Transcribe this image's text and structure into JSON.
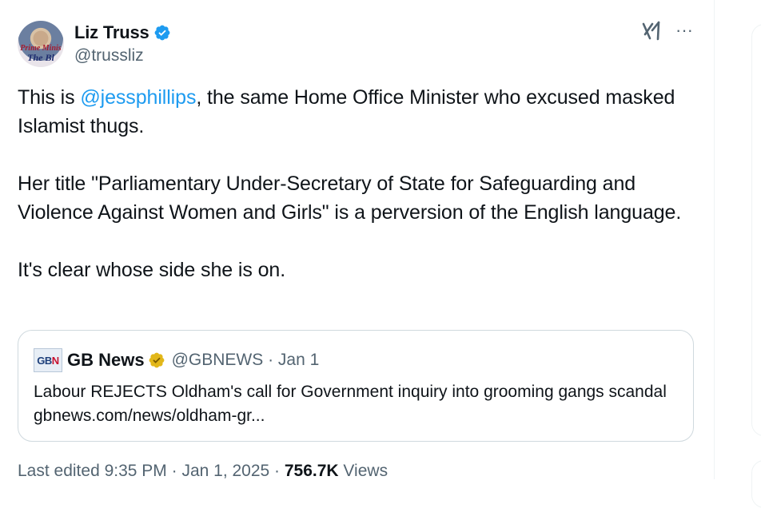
{
  "author": {
    "name": "Liz Truss",
    "handle": "@trussliz",
    "verified_icon": "verified-badge-icon",
    "avatar_lines": [
      "Prime Minis",
      "The Bl"
    ]
  },
  "header_actions": {
    "grok_icon": "grok-icon",
    "more_icon": "more-options-icon",
    "more_label": "···"
  },
  "tweet": {
    "p1_prefix": "This is ",
    "p1_mention": "@jessphillips",
    "p1_suffix": ", the same Home Office Minister who excused masked Islamist thugs.",
    "p2": "Her title \"Parliamentary Under-Secretary of State for Safeguarding and Violence Against Women and Girls\" is a perversion of the English language.",
    "p3": "It's clear whose side she is on."
  },
  "quote": {
    "logo_text_blue": "GB",
    "logo_text_red": "N",
    "name": "GB News",
    "badge_icon": "gold-verified-badge-icon",
    "handle_date": "@GBNEWS · Jan 1",
    "text": "Labour REJECTS Oldham's call for Government inquiry into grooming gangs scandal gbnews.com/news/oldham-gr..."
  },
  "footer": {
    "edited": "Last edited 9:35 PM · Jan 1, 2025 · ",
    "views_count": "756.7K",
    "views_label": " Views"
  },
  "colors": {
    "link": "#1d9bf0",
    "secondary_text": "#536471",
    "verified_blue": "#1d9bf0",
    "verified_gold": "#e2b719",
    "border": "#cfd9de"
  }
}
